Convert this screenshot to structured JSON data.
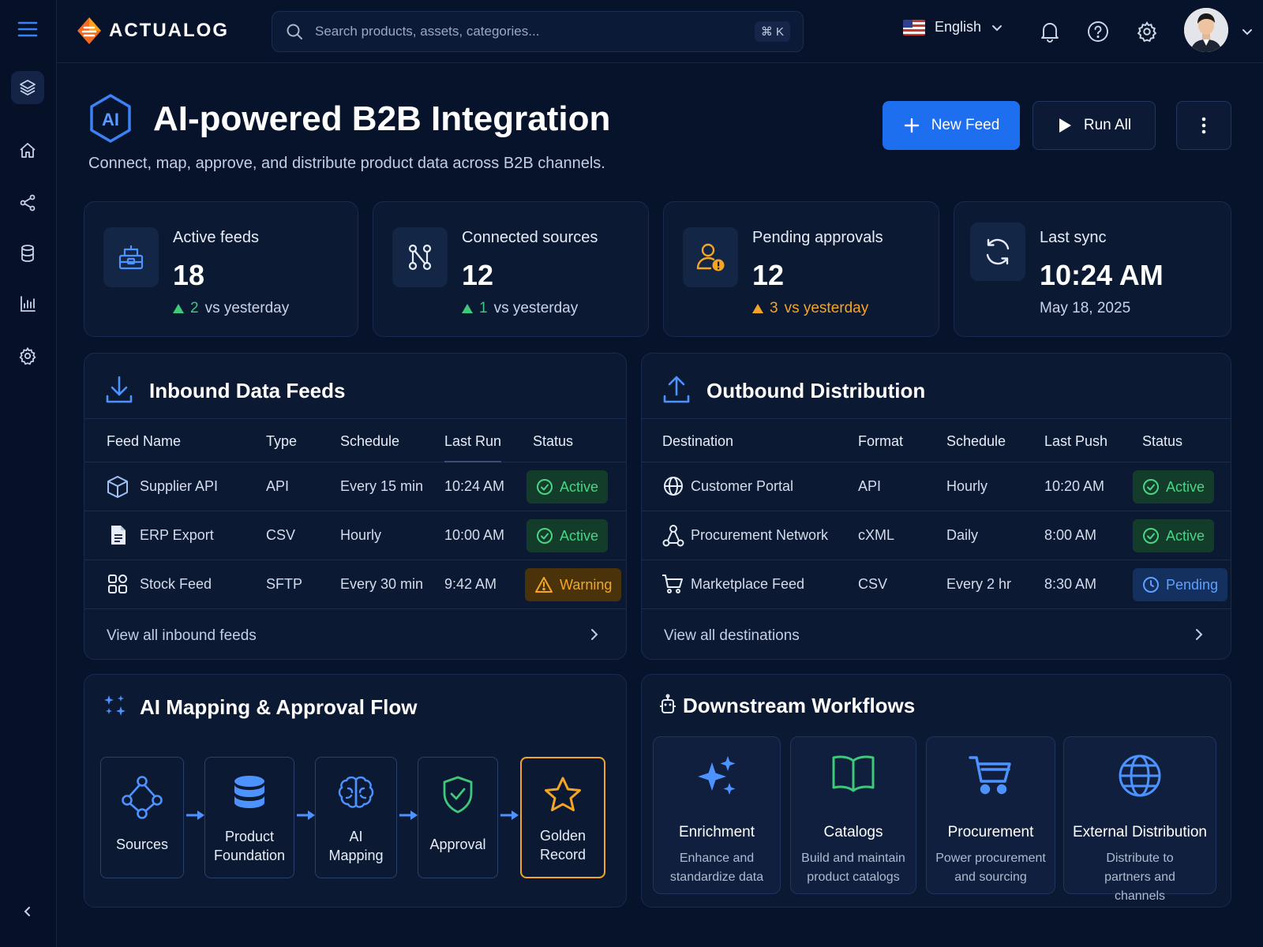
{
  "brand": {
    "name": "ACTUALOG"
  },
  "search": {
    "placeholder": "Search products, assets, categories...",
    "shortcut": "⌘ K"
  },
  "language": {
    "selected": "English"
  },
  "sidebar": {
    "items": [
      {
        "icon": "layers-icon",
        "active": true
      },
      {
        "icon": "home-icon"
      },
      {
        "icon": "share-icon"
      },
      {
        "icon": "database-icon"
      },
      {
        "icon": "chart-icon"
      },
      {
        "icon": "gear-icon"
      }
    ]
  },
  "header": {
    "badge": "AI",
    "title": "AI-powered B2B Integration",
    "subtitle": "Connect, map, approve, and distribute product data across B2B channels.",
    "new_feed_label": "New Feed",
    "run_all_label": "Run All"
  },
  "stats": [
    {
      "label": "Active feeds",
      "value": "18",
      "delta": "2",
      "delta_text": "vs yesterday",
      "trend": "up",
      "color": "#3fc87a"
    },
    {
      "label": "Connected sources",
      "value": "12",
      "delta": "1",
      "delta_text": "vs yesterday",
      "trend": "up",
      "color": "#3fc87a"
    },
    {
      "label": "Pending approvals",
      "value": "12",
      "delta": "3",
      "delta_text": "vs yesterday",
      "trend": "up",
      "color": "#f5a524"
    },
    {
      "label": "Last sync",
      "value": "10:24 AM",
      "date": "May 18, 2025"
    }
  ],
  "inbound": {
    "title": "Inbound Data Feeds",
    "columns": [
      "Feed Name",
      "Type",
      "Schedule",
      "Last Run",
      "Status"
    ],
    "rows": [
      {
        "name": "Supplier API",
        "type": "API",
        "schedule": "Every 15 min",
        "last_run": "10:24 AM",
        "status": "Active",
        "icon": "cube-icon"
      },
      {
        "name": "ERP Export",
        "type": "CSV",
        "schedule": "Hourly",
        "last_run": "10:00 AM",
        "status": "Active",
        "icon": "document-icon"
      },
      {
        "name": "Stock Feed",
        "type": "SFTP",
        "schedule": "Every 30 min",
        "last_run": "9:42 AM",
        "status": "Warning",
        "icon": "grid-icon"
      }
    ],
    "view_all": "View all inbound feeds"
  },
  "outbound": {
    "title": "Outbound Distribution",
    "columns": [
      "Destination",
      "Format",
      "Schedule",
      "Last Push",
      "Status"
    ],
    "rows": [
      {
        "name": "Customer Portal",
        "format": "API",
        "schedule": "Hourly",
        "last_push": "10:20 AM",
        "status": "Active",
        "icon": "globe-icon"
      },
      {
        "name": "Procurement Network",
        "format": "cXML",
        "schedule": "Daily",
        "last_push": "8:00 AM",
        "status": "Active",
        "icon": "network-icon"
      },
      {
        "name": "Marketplace Feed",
        "format": "CSV",
        "schedule": "Every 2 hr",
        "last_push": "8:30 AM",
        "status": "Pending",
        "icon": "cart-icon"
      }
    ],
    "view_all": "View all destinations"
  },
  "flow": {
    "title": "AI Mapping & Approval Flow",
    "steps": [
      {
        "line1": "Sources",
        "line2": "",
        "icon": "nodes-icon"
      },
      {
        "line1": "Product",
        "line2": "Foundation",
        "icon": "database-icon"
      },
      {
        "line1": "AI",
        "line2": "Mapping",
        "icon": "brain-icon"
      },
      {
        "line1": "Approval",
        "line2": "",
        "icon": "shield-check-icon"
      },
      {
        "line1": "Golden",
        "line2": "Record",
        "icon": "star-icon"
      }
    ]
  },
  "workflows": {
    "title": "Downstream Workflows",
    "items": [
      {
        "title": "Enrichment",
        "desc": "Enhance and standardize data",
        "icon": "sparkles-icon"
      },
      {
        "title": "Catalogs",
        "desc": "Build and maintain product catalogs",
        "icon": "book-icon"
      },
      {
        "title": "Procurement",
        "desc": "Power procurement and sourcing",
        "icon": "cart-icon"
      },
      {
        "title": "External Distribution",
        "desc": "Distribute to partners and channels",
        "icon": "globe-icon"
      }
    ]
  },
  "colors": {
    "accent": "#1e6ef0",
    "success": "#3fc87a",
    "warning": "#f5a524",
    "pending": "#5ea0ff",
    "background": "#07132b"
  }
}
